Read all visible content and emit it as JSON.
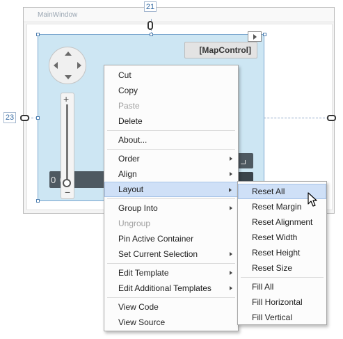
{
  "window": {
    "title": "MainWindow"
  },
  "guides": {
    "margin_top": "21",
    "margin_left": "23"
  },
  "map_control": {
    "label": "[MapControl]",
    "coordinate_text": "0   0",
    "zoom_plus": "+",
    "zoom_minus": "−"
  },
  "context_menu": {
    "groups": [
      [
        {
          "label": "Cut"
        },
        {
          "label": "Copy"
        },
        {
          "label": "Paste",
          "disabled": true
        },
        {
          "label": "Delete"
        }
      ],
      [
        {
          "label": "About..."
        }
      ],
      [
        {
          "label": "Order",
          "submenu": true
        },
        {
          "label": "Align",
          "submenu": true
        },
        {
          "label": "Layout",
          "submenu": true,
          "highlighted": true
        }
      ],
      [
        {
          "label": "Group Into",
          "submenu": true
        },
        {
          "label": "Ungroup",
          "disabled": true
        },
        {
          "label": "Pin Active Container"
        },
        {
          "label": "Set Current Selection",
          "submenu": true
        }
      ],
      [
        {
          "label": "Edit Template",
          "submenu": true
        },
        {
          "label": "Edit Additional Templates",
          "submenu": true
        }
      ],
      [
        {
          "label": "View Code"
        },
        {
          "label": "View Source"
        }
      ]
    ]
  },
  "layout_submenu": {
    "groups": [
      [
        {
          "label": "Reset All",
          "highlighted": true
        },
        {
          "label": "Reset Margin"
        },
        {
          "label": "Reset Alignment"
        },
        {
          "label": "Reset Width"
        },
        {
          "label": "Reset Height"
        },
        {
          "label": "Reset Size"
        }
      ],
      [
        {
          "label": "Fill All"
        },
        {
          "label": "Fill Horizontal"
        },
        {
          "label": "Fill Vertical"
        }
      ]
    ]
  },
  "colors": {
    "highlight": "#cfe0f7",
    "map_background": "#cde6f3",
    "disabled_text": "#a0a0a0"
  },
  "icons": [
    "chain-link-icon",
    "smart-tag-arrow-icon",
    "navigation-pad-icon",
    "zoom-slider-icon",
    "submenu-arrow-icon",
    "mouse-cursor-icon"
  ]
}
